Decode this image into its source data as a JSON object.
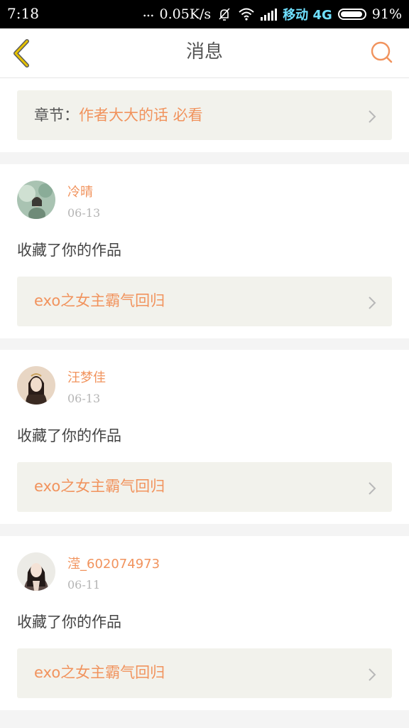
{
  "status_bar": {
    "time": "7:18",
    "dots": "...",
    "speed": "0.05K/s",
    "carrier": "移动 4G",
    "battery": "91%"
  },
  "header": {
    "title": "消息",
    "back_icon": "chevron-left-icon",
    "search_icon": "search-icon",
    "accent_color": "#f1935d",
    "back_color": "#e5c100"
  },
  "chapter": {
    "label": "章节：",
    "value": "作者大大的话 必看"
  },
  "messages": [
    {
      "username": "冷晴",
      "date": "06-13",
      "action": "收藏了你的作品",
      "work": "exo之女主霸气回归"
    },
    {
      "username": "汪梦佳",
      "date": "06-13",
      "action": "收藏了你的作品",
      "work": "exo之女主霸气回归"
    },
    {
      "username": "滢_602074973",
      "date": "06-11",
      "action": "收藏了你的作品",
      "work": "exo之女主霸气回归"
    }
  ]
}
